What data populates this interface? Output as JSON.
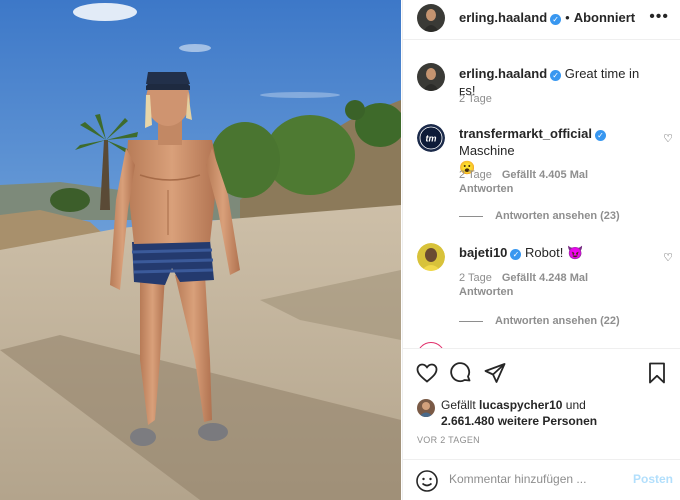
{
  "header": {
    "username": "erling.haaland",
    "separator": "•",
    "follow_label": "Abonniert",
    "more_label": "•••"
  },
  "caption": {
    "username": "erling.haaland",
    "text": "Great time in ᴇs!",
    "time": "2 Tage"
  },
  "comments": [
    {
      "username": "transfermarkt_official",
      "text": "Maschine",
      "emoji": "😮",
      "time": "2 Tage",
      "likes": "Gefällt 4.405 Mal",
      "reply_label": "Antworten",
      "view_replies": "Antworten ansehen (23)",
      "avatar_text": "tm"
    },
    {
      "username": "bajeti10",
      "text": "Robot!",
      "emoji": "😈",
      "time": "2 Tage",
      "likes": "Gefällt 4.248 Mal",
      "reply_label": "Antworten",
      "view_replies": "Antworten ansehen (22)"
    }
  ],
  "likes": {
    "prefix": "Gefällt",
    "user": "lucaspycher10",
    "connector": "und",
    "count": "2.661.480 weitere Personen"
  },
  "timestamp": "VOR 2 TAGEN",
  "comment_input": {
    "placeholder": "Kommentar hinzufügen ...",
    "post_label": "Posten"
  },
  "colors": {
    "verified": "#3897f0",
    "muted": "#8e8e8e",
    "post_disabled": "#b2dffc"
  },
  "icons": [
    "more-icon",
    "heart-icon",
    "comment-icon",
    "share-icon",
    "bookmark-icon",
    "emoji-icon",
    "verified-icon"
  ]
}
